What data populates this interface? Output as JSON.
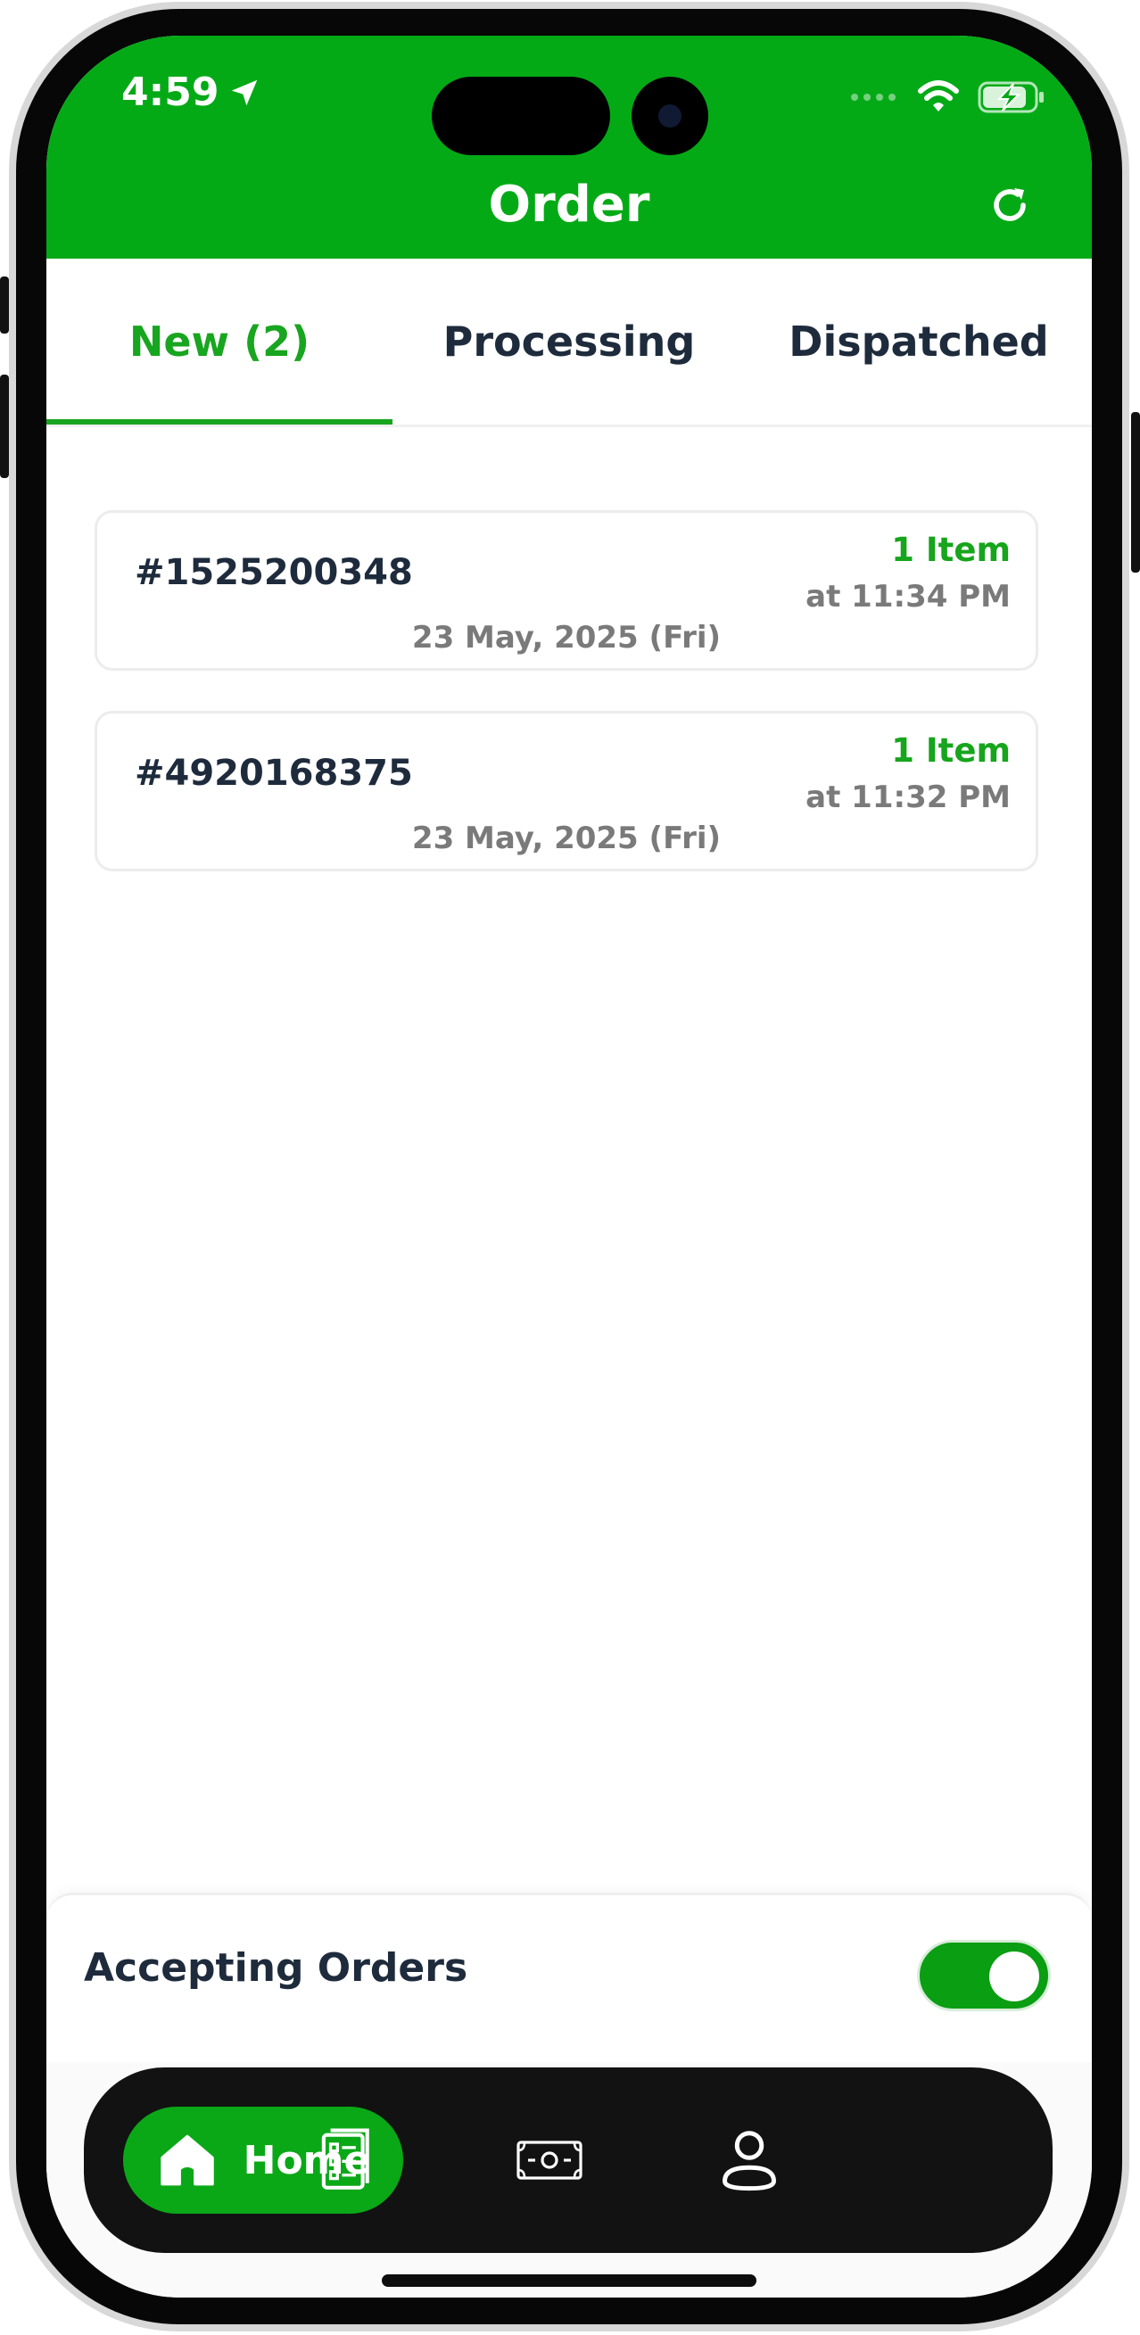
{
  "status_bar": {
    "time": "4:59"
  },
  "header": {
    "title": "Order"
  },
  "tabs": [
    {
      "label": "New (2)",
      "active": true
    },
    {
      "label": "Processing",
      "active": false
    },
    {
      "label": "Dispatched",
      "active": false
    }
  ],
  "orders": [
    {
      "id": "#1525200348",
      "items": "1 Item",
      "time": "at 11:34 PM",
      "date": "23 May, 2025 (Fri)"
    },
    {
      "id": "#4920168375",
      "items": "1 Item",
      "time": "at 11:32 PM",
      "date": "23 May, 2025 (Fri)"
    }
  ],
  "accepting": {
    "label": "Accepting Orders",
    "enabled": true
  },
  "nav": {
    "home_label": "Home",
    "icons": [
      "home-icon",
      "order-list-icon",
      "cash-icon",
      "profile-icon"
    ]
  },
  "colors": {
    "brand_green": "#04aa16",
    "text_dark": "#1e2b3c",
    "text_muted": "#7a7a7a",
    "nav_dark": "#121212"
  }
}
